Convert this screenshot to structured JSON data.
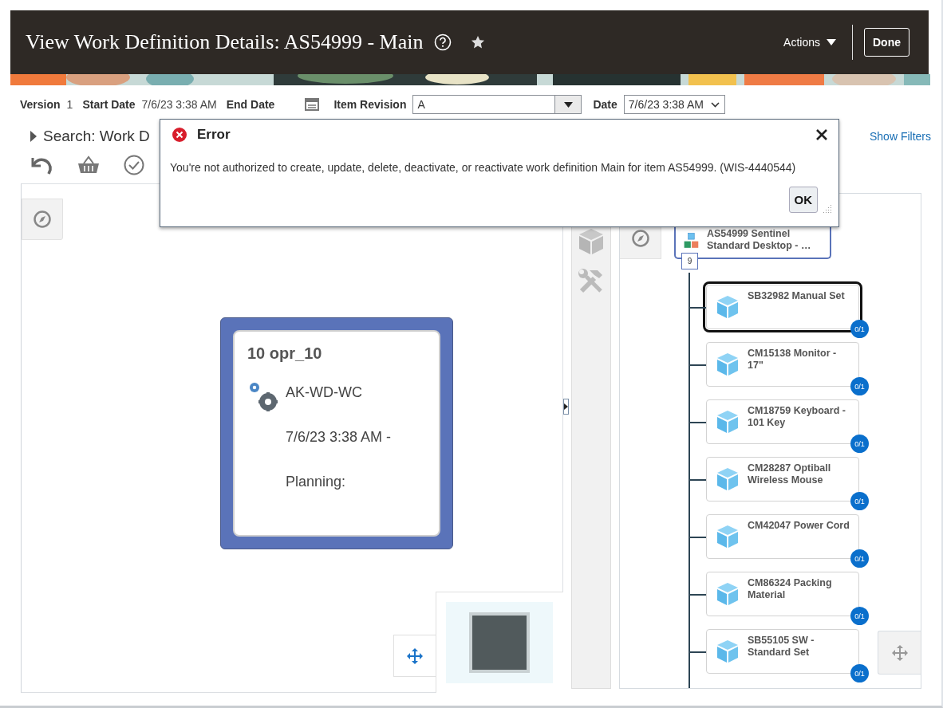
{
  "header": {
    "title": "View Work Definition Details: AS54999 - Main",
    "actions_label": "Actions",
    "done_label": "Done"
  },
  "info": {
    "version_label": "Version",
    "version": "1",
    "start_date_label": "Start Date",
    "start_date": "7/6/23 3:38 AM",
    "end_date_label": "End Date",
    "item_revision_label": "Item Revision",
    "item_revision": "A",
    "date_label": "Date",
    "date": "7/6/23 3:38 AM"
  },
  "search": {
    "label": "Search: Work D",
    "expanded": false
  },
  "show_filters": "Show Filters",
  "dialog": {
    "title": "Error",
    "message": "You're not authorized to create, update, delete, deactivate, or reactivate work definition Main for item AS54999. (WIS-4440544)",
    "ok": "OK"
  },
  "operation": {
    "title": "10 opr_10",
    "work_center": "AK-WD-WC",
    "dates": "7/6/23 3:38 AM -",
    "planning": "Planning:"
  },
  "structure": {
    "root": {
      "name": "AS54999 Sentinel Standard Desktop - …",
      "count": "9"
    },
    "components": [
      {
        "name": "SB32982 Manual Set",
        "quantity": "0/1",
        "selected": true
      },
      {
        "name": "CM15138 Monitor - 17\"",
        "quantity": "0/1",
        "selected": false
      },
      {
        "name": "CM18759 Keyboard - 101 Key",
        "quantity": "0/1",
        "selected": false
      },
      {
        "name": "CM28287 Optiball Wireless Mouse",
        "quantity": "0/1",
        "selected": false
      },
      {
        "name": "CM42047 Power Cord",
        "quantity": "0/1",
        "selected": false
      },
      {
        "name": "CM86324 Packing Material",
        "quantity": "0/1",
        "selected": false
      },
      {
        "name": "SB55105 SW - Standard Set",
        "quantity": "0/1",
        "selected": false
      }
    ]
  }
}
